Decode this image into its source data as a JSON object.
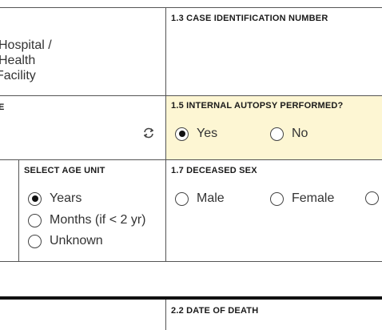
{
  "row1": {
    "left_text_lines": [
      "Hospital /",
      "Health",
      "Facility"
    ],
    "right_label": "1.3 CASE IDENTIFICATION NUMBER",
    "case_id_value": ""
  },
  "row2": {
    "left_label_fragment": "E",
    "refresh_icon": "refresh-icon",
    "autopsy_label": "1.5 INTERNAL AUTOPSY PERFORMED?",
    "autopsy_options": [
      {
        "label": "Yes",
        "checked": true
      },
      {
        "label": "No",
        "checked": false
      }
    ],
    "highlight_color": "#fdf6d3"
  },
  "row3": {
    "age_unit_label": "SELECT AGE UNIT",
    "age_unit_options": [
      {
        "label": "Years",
        "checked": true
      },
      {
        "label": "Months (if < 2 yr)",
        "checked": false
      },
      {
        "label": "Unknown",
        "checked": false
      }
    ],
    "sex_label": "1.7 DECEASED SEX",
    "sex_options": [
      {
        "label": "Male",
        "checked": false
      },
      {
        "label": "Female",
        "checked": false
      },
      {
        "label": "",
        "checked": false
      }
    ]
  },
  "row4": {
    "date_of_death_label": "2.2 DATE OF DEATH"
  }
}
